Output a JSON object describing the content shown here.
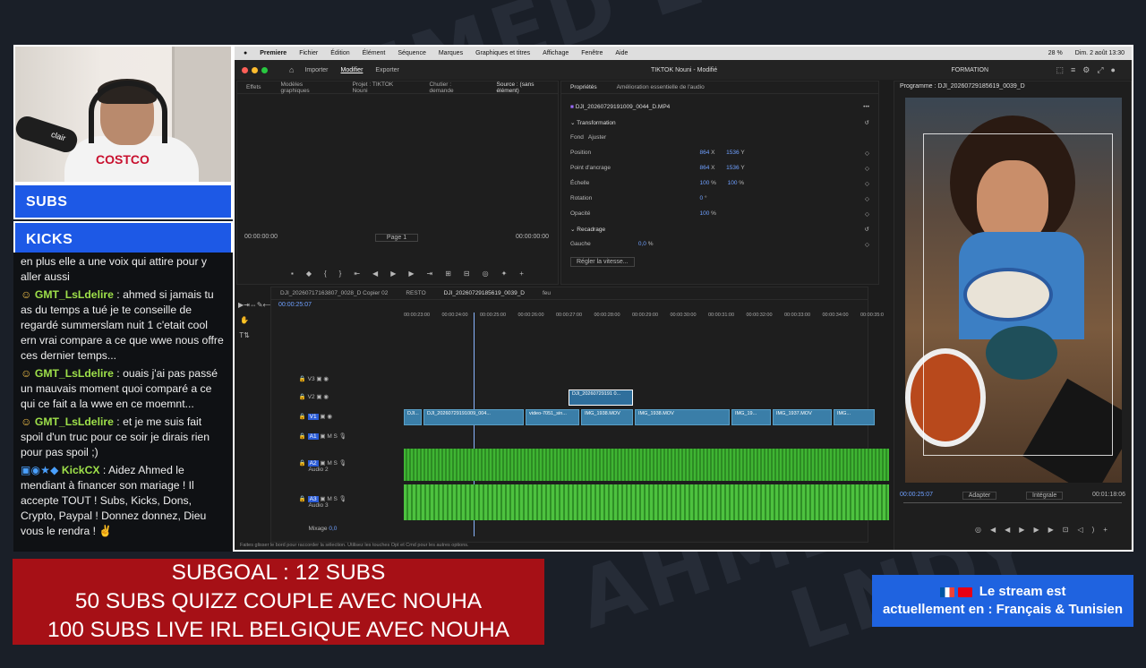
{
  "watermark": [
    "AHMED",
    "LNDY",
    "AHMED LNDY"
  ],
  "webcam": {
    "shirt_brand": "COSTCO",
    "mic_label": "clair"
  },
  "subs_label": "SUBS",
  "kicks_label": "KICKS",
  "chat": {
    "messages": [
      {
        "user": "",
        "text": "en plus elle a une voix qui attire pour y aller aussi"
      },
      {
        "user": "GMT_LsLdelire",
        "text": "ahmed si jamais tu as du temps a tué je te conseille de regardé summerslam nuit 1 c'etait cool ern vrai compare a ce que wwe nous offre ces dernier temps..."
      },
      {
        "user": "GMT_LsLdelire",
        "text": "ouais j'ai pas passé un mauvais moment quoi comparé a ce qui ce fait a la wwe en ce moemnt..."
      },
      {
        "user": "GMT_LsLdelire",
        "text": "et je me suis fait spoil d'un truc pour ce soir je dirais rien pour pas spoil ;)"
      },
      {
        "user": "KickCX",
        "text": "Aidez Ahmed le mendiant à financer son mariage ! Il accepte TOUT ! Subs, Kicks, Dons, Crypto, Paypal ! Donnez donnez, Dieu vous le rendra ! ✌"
      }
    ]
  },
  "mac_menu": [
    "Premiere",
    "Fichier",
    "Édition",
    "Élément",
    "Séquence",
    "Marques",
    "Graphiques et titres",
    "Affichage",
    "Fenêtre",
    "Aide"
  ],
  "mac_status": {
    "battery": "28 %",
    "datetime": "Dim. 2 août 13:30"
  },
  "premiere": {
    "top_tabs": [
      "Importer",
      "Modifier",
      "Exporter"
    ],
    "project_title": "TIKTOK Nouni - Modifié",
    "workspace": "FORMATION",
    "source_tabs": [
      "Effets",
      "Modèles graphiques",
      "Projet : TIKTOK Nouni",
      "Chutier : demande",
      "Source : (sans élément)"
    ],
    "source_timecode_left": "00:00:00:00",
    "source_page": "Page 1",
    "source_timecode_right": "00:00:00:00",
    "props_tabs": [
      "Propriétés",
      "Amélioration essentielle de l'audio"
    ],
    "clip_name": "DJI_20260729191009_0044_D.MP4",
    "transform_label": "Transformation",
    "fit_options": [
      "Fond",
      "Ajuster"
    ],
    "properties": [
      {
        "name": "Position",
        "v1": "864",
        "u1": "X",
        "v2": "1536",
        "u2": "Y"
      },
      {
        "name": "Point d'ancrage",
        "v1": "864",
        "u1": "X",
        "v2": "1536",
        "u2": "Y"
      },
      {
        "name": "Échelle",
        "v1": "100",
        "u1": "%",
        "v2": "100",
        "u2": "%"
      },
      {
        "name": "Rotation",
        "v1": "0",
        "u1": "°",
        "v2": "",
        "u2": ""
      },
      {
        "name": "Opacité",
        "v1": "100",
        "u1": "%",
        "v2": "",
        "u2": ""
      }
    ],
    "crop_label": "Recadrage",
    "crop_left": {
      "name": "Gauche",
      "value": "0,0",
      "unit": "%"
    },
    "speed_button": "Régler la vitesse...",
    "program_title": "Programme : DJI_20260729185619_0039_D",
    "program_timecode": "00:00:25:07",
    "program_fit": "Adapter",
    "program_quality": "Intégrale",
    "program_duration": "00:01:18:06",
    "timeline_tabs": [
      "DJI_20260717163807_0028_D Copier 02",
      "RESTO",
      "DJI_20260729185619_0039_D",
      "feu"
    ],
    "timeline_timecode": "00:00:25:07",
    "ruler": [
      "00:00:23:00",
      "00:00:24:00",
      "00:00:25:00",
      "00:00:26:00",
      "00:00:27:00",
      "00:00:28:00",
      "00:00:29:00",
      "00:00:30:00",
      "00:00:31:00",
      "00:00:32:00",
      "00:00:33:00",
      "00:00:34:00",
      "00:00:35:0"
    ],
    "tracks": {
      "video": [
        "V3",
        "V2",
        "V1"
      ],
      "audio": [
        "A1",
        "A2",
        "A3"
      ],
      "audio2_name": "Audio 2",
      "audio3_name": "Audio 3",
      "mix": "Mixage",
      "mix_val": "0,0"
    },
    "clips_v1": [
      "DJI...",
      "DJI_20260729191009_004...",
      "video-7051_sin...",
      "IMG_1938.MOV",
      "IMG_1938.MOV",
      "IMG_19...",
      "IMG_1937.MOV",
      "IMG..."
    ],
    "clip_v2": "DJI_20260729191 0...",
    "status_hint": "Faites glisser le bord pour raccorder la sélection. Utilisez les touches Opt et Cmd pour les autres options."
  },
  "subgoal": [
    "SUBGOAL : 12 SUBS",
    "50 SUBS QUIZZ COUPLE AVEC NOUHA",
    "100 SUBS LIVE IRL BELGIQUE AVEC NOUHA"
  ],
  "stream_lang": {
    "line1": "Le stream est",
    "line2": "actuellement en : Français & Tunisien"
  }
}
